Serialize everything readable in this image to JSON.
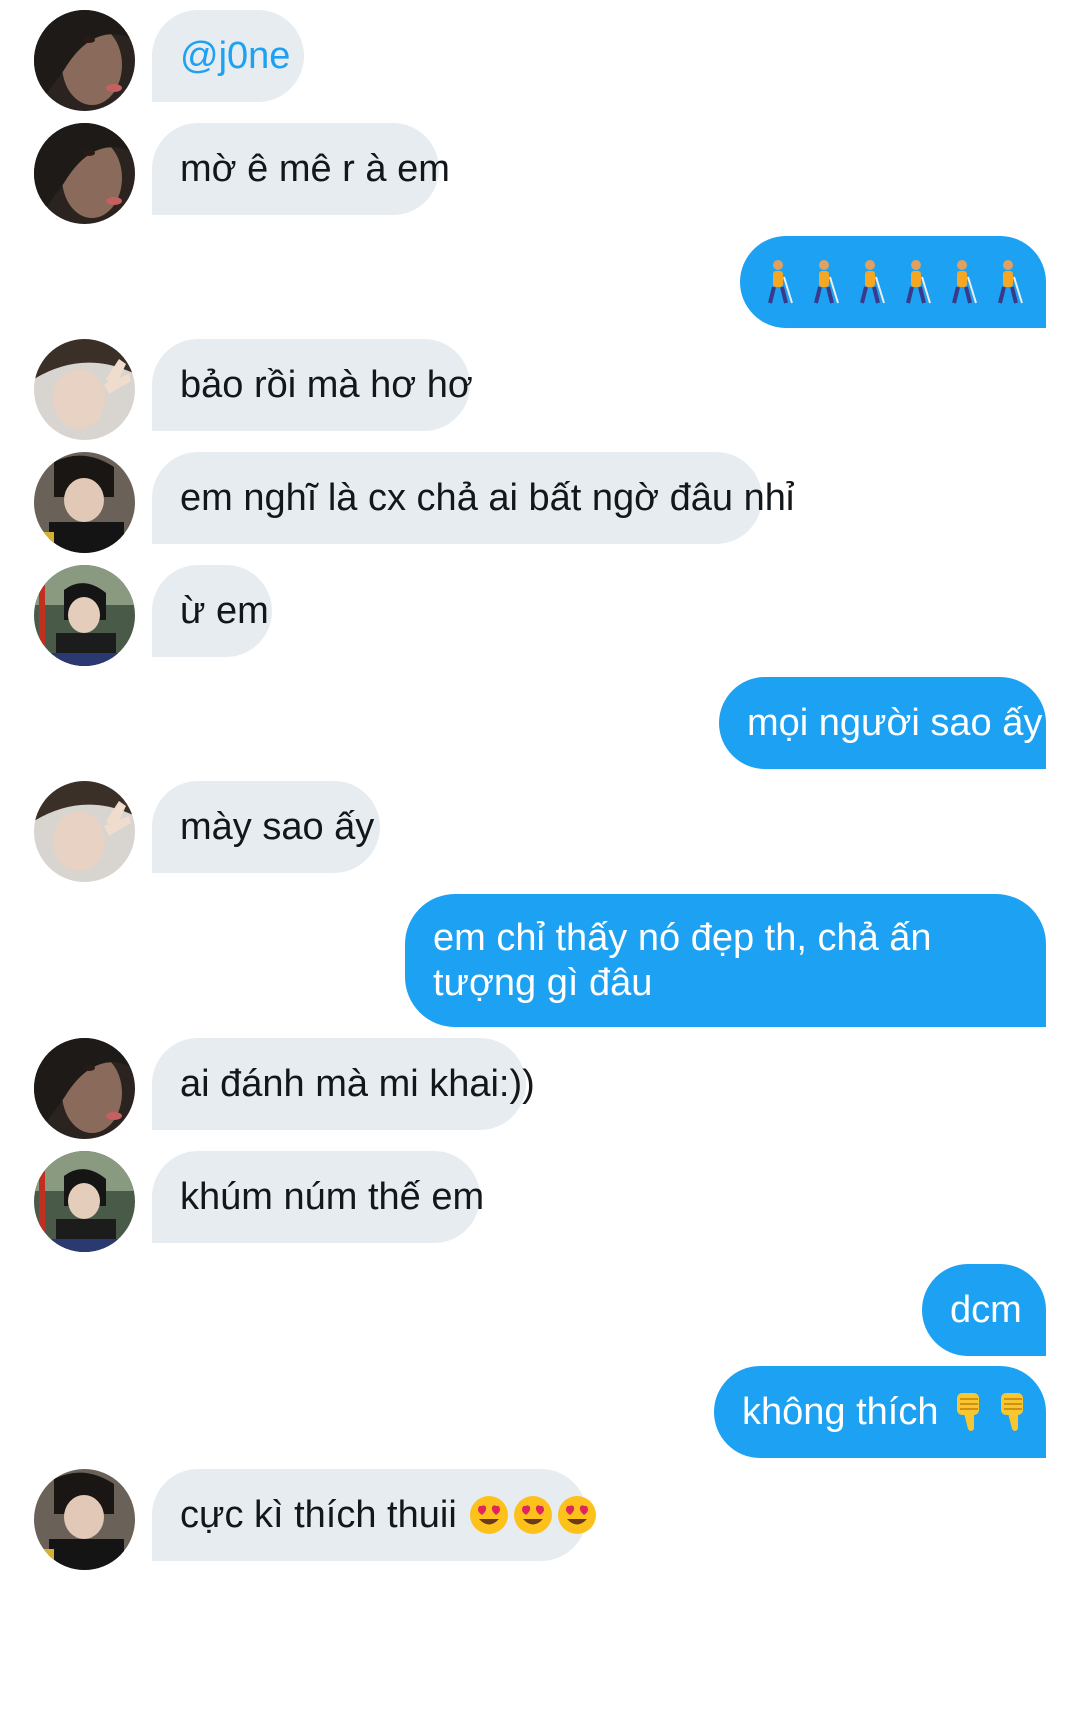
{
  "colors": {
    "incoming_bubble": "#e6ecf0",
    "outgoing_bubble": "#1da1f2",
    "mention": "#1da1f2"
  },
  "messages": [
    {
      "side": "in",
      "avatar": "avatar-a",
      "text": "@j0ne"
    },
    {
      "side": "in",
      "avatar": "avatar-a",
      "text": "mờ ê mê r à em"
    },
    {
      "side": "out",
      "emoji": [
        "person-with-white-cane-icon",
        "person-with-white-cane-icon",
        "person-with-white-cane-icon",
        "person-with-white-cane-icon",
        "person-with-white-cane-icon",
        "person-with-white-cane-icon"
      ]
    },
    {
      "side": "in",
      "avatar": "avatar-b",
      "text": "bảo rồi mà hơ hơ"
    },
    {
      "side": "in",
      "avatar": "avatar-c",
      "text": "em nghĩ là cx chả ai bất ngờ đâu nhỉ"
    },
    {
      "side": "in",
      "avatar": "avatar-d",
      "text": "ừ em"
    },
    {
      "side": "out",
      "text": "mọi người sao ấy"
    },
    {
      "side": "in",
      "avatar": "avatar-b",
      "text": "mày sao ấy"
    },
    {
      "side": "out",
      "text": "em chỉ thấy nó đẹp th, chả ấn tượng gì đâu"
    },
    {
      "side": "in",
      "avatar": "avatar-a",
      "text": "ai đánh mà mi khai:))"
    },
    {
      "side": "in",
      "avatar": "avatar-d",
      "text": "khúm núm thế em"
    },
    {
      "side": "out",
      "text": "dcm"
    },
    {
      "side": "out",
      "text": "không thích",
      "emoji": [
        "thumbs-down-icon",
        "thumbs-down-icon"
      ]
    },
    {
      "side": "in",
      "avatar": "avatar-c",
      "text": "cực kì thích thuii",
      "emoji": [
        "heart-eyes-icon",
        "heart-eyes-icon",
        "heart-eyes-icon"
      ]
    }
  ]
}
